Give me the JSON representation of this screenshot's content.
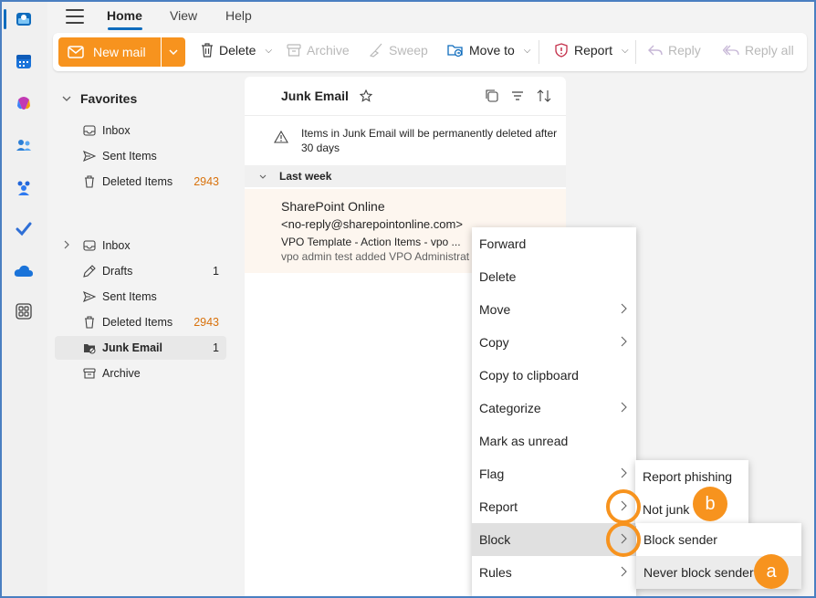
{
  "top_tabs": {
    "home": "Home",
    "view": "View",
    "help": "Help"
  },
  "ribbon": {
    "new_mail": "New mail",
    "delete": "Delete",
    "archive": "Archive",
    "sweep": "Sweep",
    "move_to": "Move to",
    "report": "Report",
    "reply": "Reply",
    "reply_all": "Reply all"
  },
  "favorites": {
    "header": "Favorites",
    "items": [
      {
        "label": "Inbox",
        "count": ""
      },
      {
        "label": "Sent Items",
        "count": ""
      },
      {
        "label": "Deleted Items",
        "count": "2943"
      }
    ]
  },
  "folders": [
    {
      "label": "Inbox",
      "count": ""
    },
    {
      "label": "Drafts",
      "count": "1"
    },
    {
      "label": "Sent Items",
      "count": ""
    },
    {
      "label": "Deleted Items",
      "count": "2943"
    },
    {
      "label": "Junk Email",
      "count": "1"
    },
    {
      "label": "Archive",
      "count": ""
    }
  ],
  "message_list": {
    "title": "Junk Email",
    "notice": "Items in Junk Email will be permanently deleted after 30 days",
    "group": "Last week",
    "message": {
      "sender": "SharePoint Online",
      "address": "<no-reply@sharepointonline.com>",
      "subject": "VPO Template - Action Items - vpo ...",
      "preview": "vpo admin test added VPO Administrat"
    }
  },
  "context_menu": [
    "Forward",
    "Delete",
    "Move",
    "Copy",
    "Copy to clipboard",
    "Categorize",
    "Mark as unread",
    "Flag",
    "Report",
    "Block",
    "Rules"
  ],
  "report_submenu": [
    "Report phishing",
    "Not junk"
  ],
  "block_submenu": [
    "Block sender",
    "Never block sender"
  ],
  "callouts": {
    "a": "a",
    "b": "b"
  },
  "colors": {
    "accent": "#f7931e",
    "brand": "#0f6cbd",
    "count_orange": "#d8720c"
  }
}
